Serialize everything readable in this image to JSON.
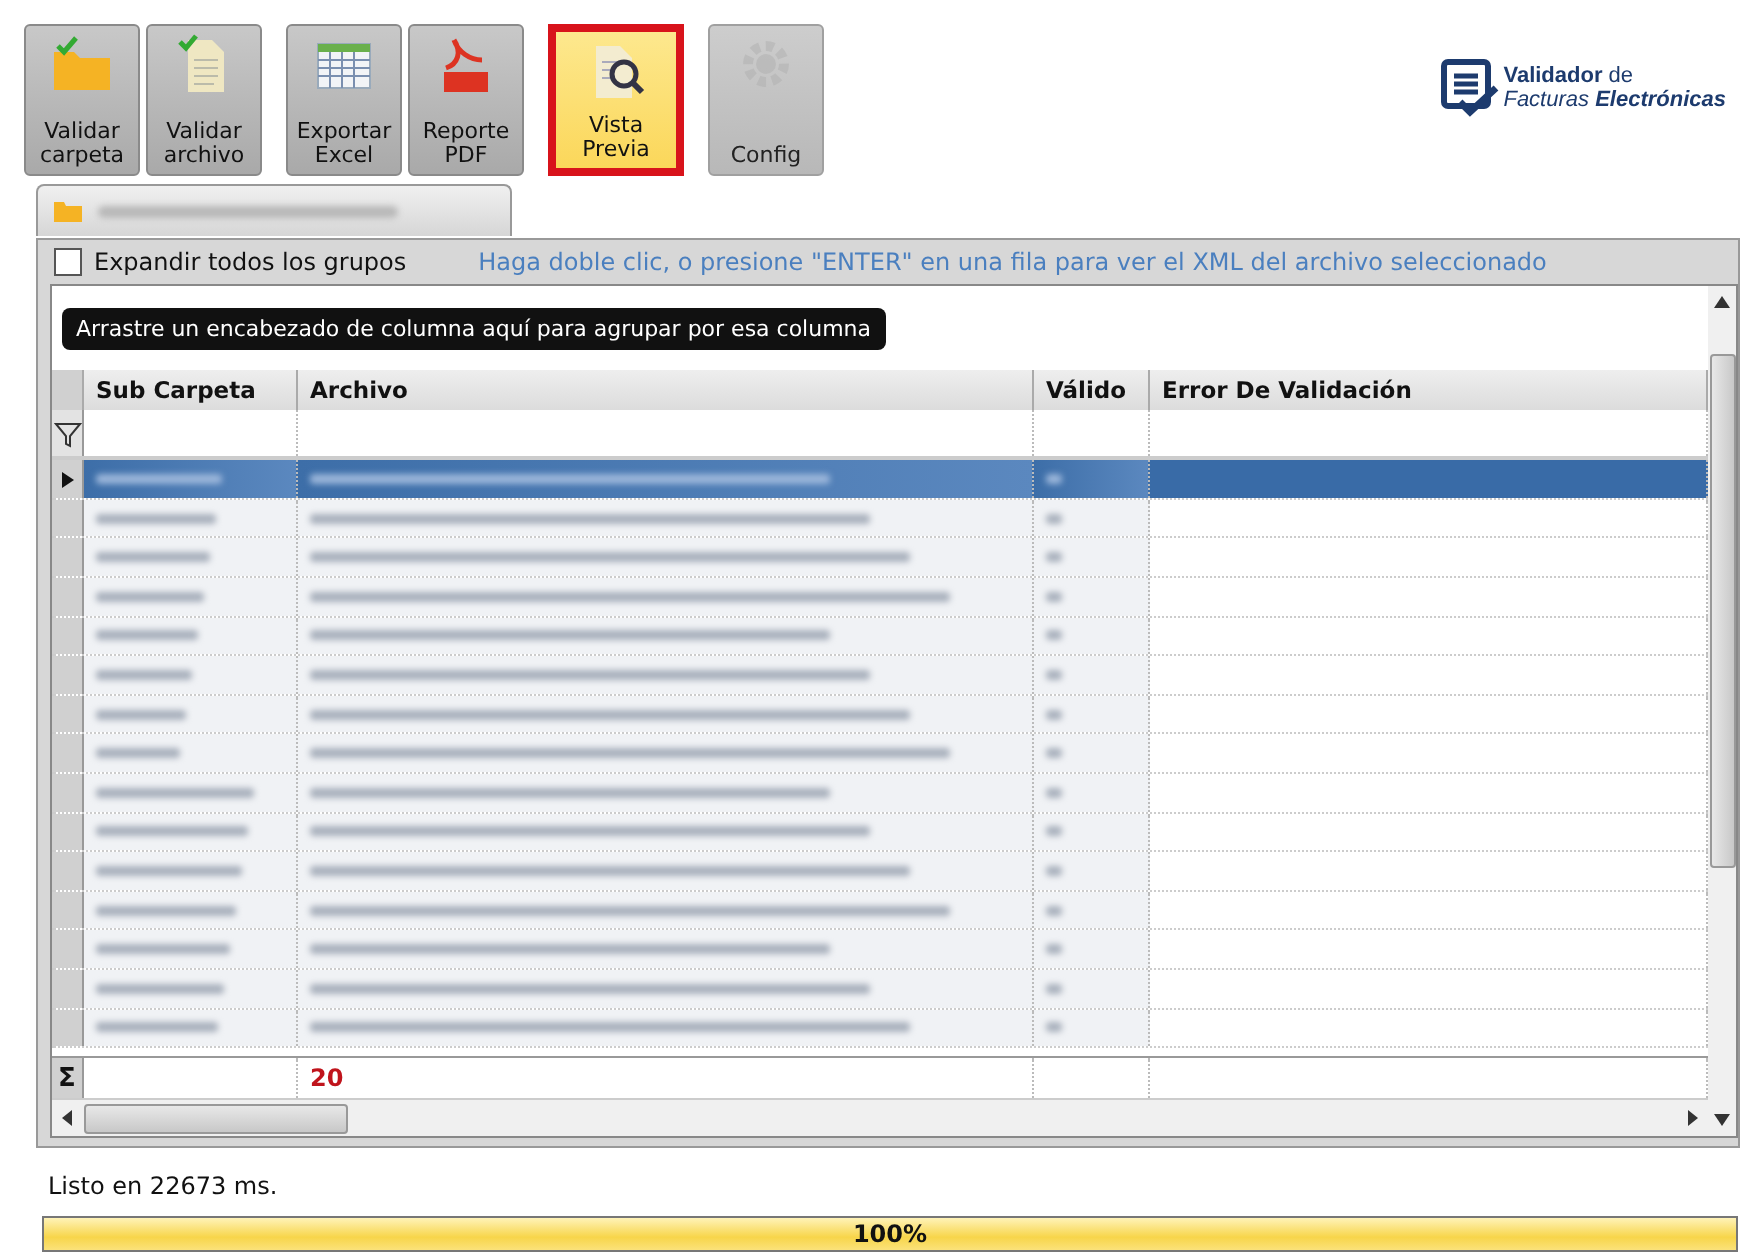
{
  "toolbar": [
    {
      "kind": "folder",
      "label": "Validar carpeta",
      "selected": false,
      "disabled": false
    },
    {
      "kind": "file",
      "label": "Validar archivo",
      "selected": false,
      "disabled": false
    },
    {
      "kind": "excel",
      "label": "Exportar Excel",
      "selected": false,
      "disabled": false
    },
    {
      "kind": "pdf",
      "label": "Reporte PDF",
      "selected": false,
      "disabled": false
    },
    {
      "kind": "preview",
      "label": "Vista Previa",
      "selected": true,
      "disabled": false
    },
    {
      "kind": "gear",
      "label": "Config",
      "selected": false,
      "disabled": true
    }
  ],
  "logo": {
    "name_bold": "Validador",
    "name_rest": "de",
    "line2_light": "Facturas",
    "line2_bold": "Electrónicas"
  },
  "expand_all": {
    "label": "Expandir todos los grupos",
    "checked": false
  },
  "hint": "Haga doble clic, o presione \"ENTER\" en una fila para ver el XML del archivo seleccionado",
  "group_panel": "Arrastre un encabezado de columna aquí para agrupar por esa columna",
  "columns": [
    "Sub Carpeta",
    "Archivo",
    "Válido",
    "Error De Validación"
  ],
  "rows": [
    {
      "selected": true
    },
    {
      "selected": false
    },
    {
      "selected": false
    },
    {
      "selected": false
    },
    {
      "selected": false
    },
    {
      "selected": false
    },
    {
      "selected": false
    },
    {
      "selected": false
    },
    {
      "selected": false
    },
    {
      "selected": false
    },
    {
      "selected": false
    },
    {
      "selected": false
    },
    {
      "selected": false
    },
    {
      "selected": false
    },
    {
      "selected": false
    }
  ],
  "summary": {
    "sigma": "Σ",
    "count": "20"
  },
  "status": "Listo en 22673 ms.",
  "progress": {
    "level": 1,
    "label": "100%"
  }
}
